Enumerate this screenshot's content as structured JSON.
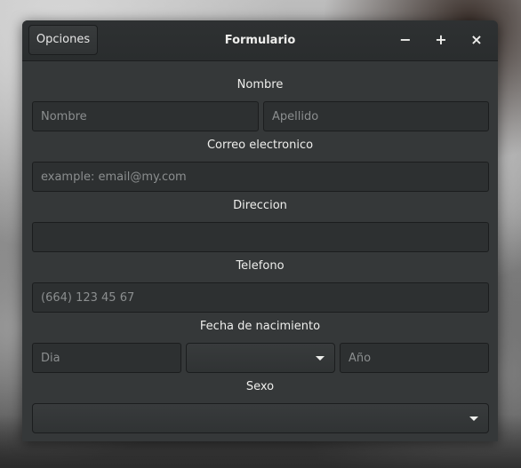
{
  "window": {
    "title": "Formulario",
    "menu_button": "Opciones",
    "minimize": "−",
    "maximize": "+",
    "close": "×"
  },
  "form": {
    "nombre_label": "Nombre",
    "nombre_placeholder": "Nombre",
    "apellido_placeholder": "Apellido",
    "correo_label": "Correo electronico",
    "correo_placeholder": "example: email@my.com",
    "direccion_label": "Direccion",
    "direccion_placeholder": "",
    "telefono_label": "Telefono",
    "telefono_placeholder": "(664) 123 45 67",
    "fecha_label": "Fecha de nacimiento",
    "dia_placeholder": "Dia",
    "mes_value": "",
    "anio_placeholder": "Año",
    "sexo_label": "Sexo",
    "sexo_value": ""
  },
  "colors": {
    "window_bg": "#353839",
    "headerbar_bg": "#2b2e2f",
    "entry_bg": "#2d3031",
    "text": "#eeeeec",
    "placeholder": "#8b8e8f"
  },
  "icons": {
    "dropdown": "chevron-down-icon",
    "minimize": "minimize-icon",
    "maximize": "maximize-icon",
    "close": "close-icon"
  }
}
